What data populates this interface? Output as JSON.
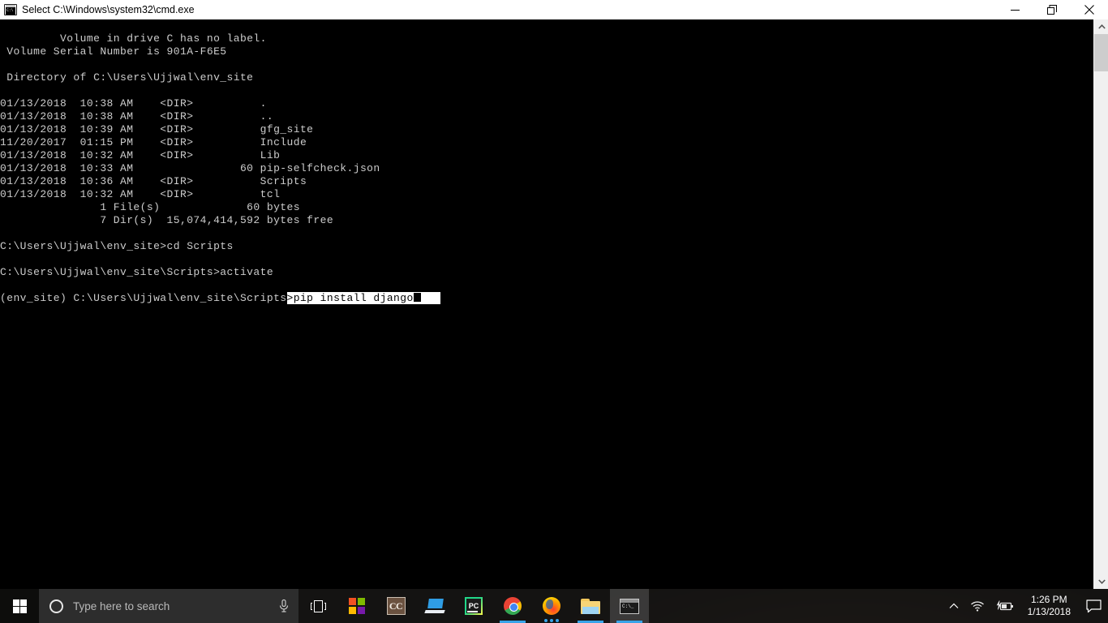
{
  "window": {
    "title": "Select C:\\Windows\\system32\\cmd.exe",
    "icon": "cmd-console-icon",
    "controls": {
      "minimize": "minimize-button",
      "restore": "restore-button",
      "close": "close-button"
    }
  },
  "console": {
    "background_color": "#000000",
    "text_color": "#cccccc",
    "selection_background": "#ffffff",
    "selection_text": "#000000",
    "lines": [
      " Volume in drive C has no label.",
      " Volume Serial Number is 901A-F6E5",
      "",
      " Directory of C:\\Users\\Ujjwal\\env_site",
      "",
      "01/13/2018  10:38 AM    <DIR>          .",
      "01/13/2018  10:38 AM    <DIR>          ..",
      "01/13/2018  10:39 AM    <DIR>          gfg_site",
      "11/20/2017  01:15 PM    <DIR>          Include",
      "01/13/2018  10:32 AM    <DIR>          Lib",
      "01/13/2018  10:33 AM                60 pip-selfcheck.json",
      "01/13/2018  10:36 AM    <DIR>          Scripts",
      "01/13/2018  10:32 AM    <DIR>          tcl",
      "               1 File(s)             60 bytes",
      "               7 Dir(s)  15,074,414,592 bytes free",
      "",
      "C:\\Users\\Ujjwal\\env_site>cd Scripts",
      "",
      "C:\\Users\\Ujjwal\\env_site\\Scripts>activate",
      ""
    ],
    "prompt_line": {
      "unselected_prefix": "(env_site) C:\\Users\\Ujjwal\\env_site\\Scripts",
      "selected_text": ">pip install django",
      "selected_trailing": "   "
    }
  },
  "scrollbar": {
    "up_arrow": "scroll-up-arrow",
    "down_arrow": "scroll-down-arrow",
    "thumb": "scroll-thumb"
  },
  "taskbar": {
    "start_label": "Start",
    "search": {
      "placeholder": "Type here to search",
      "cortana_icon": "cortana-circle-icon",
      "mic_icon": "microphone-icon"
    },
    "buttons": [
      {
        "name": "task-view",
        "label": "Task View",
        "icon": "task-view-icon",
        "state": "none"
      },
      {
        "name": "microsoft-store",
        "label": "Microsoft Store",
        "icon": "microsoft-store-icon",
        "state": "none"
      },
      {
        "name": "cc-app",
        "label": "CC",
        "icon": "cc-icon",
        "state": "none"
      },
      {
        "name": "remote-desktop",
        "label": "Remote Desktop",
        "icon": "laptop-icon",
        "state": "none"
      },
      {
        "name": "pycharm",
        "label": "PyCharm",
        "icon": "pycharm-icon",
        "state": "none"
      },
      {
        "name": "google-chrome",
        "label": "Google Chrome",
        "icon": "chrome-icon",
        "state": "running"
      },
      {
        "name": "mozilla-firefox",
        "label": "Mozilla Firefox",
        "icon": "firefox-icon",
        "state": "loading"
      },
      {
        "name": "file-explorer",
        "label": "File Explorer",
        "icon": "folder-icon",
        "state": "running"
      },
      {
        "name": "command-prompt",
        "label": "Command Prompt",
        "icon": "cmd-icon",
        "state": "active"
      }
    ],
    "tray": {
      "show_hidden_icons": "chevron-up-icon",
      "network": "wifi-icon",
      "battery": "battery-charging-icon",
      "time": "1:26 PM",
      "date": "1/13/2018",
      "action_center": "action-center-icon"
    }
  }
}
